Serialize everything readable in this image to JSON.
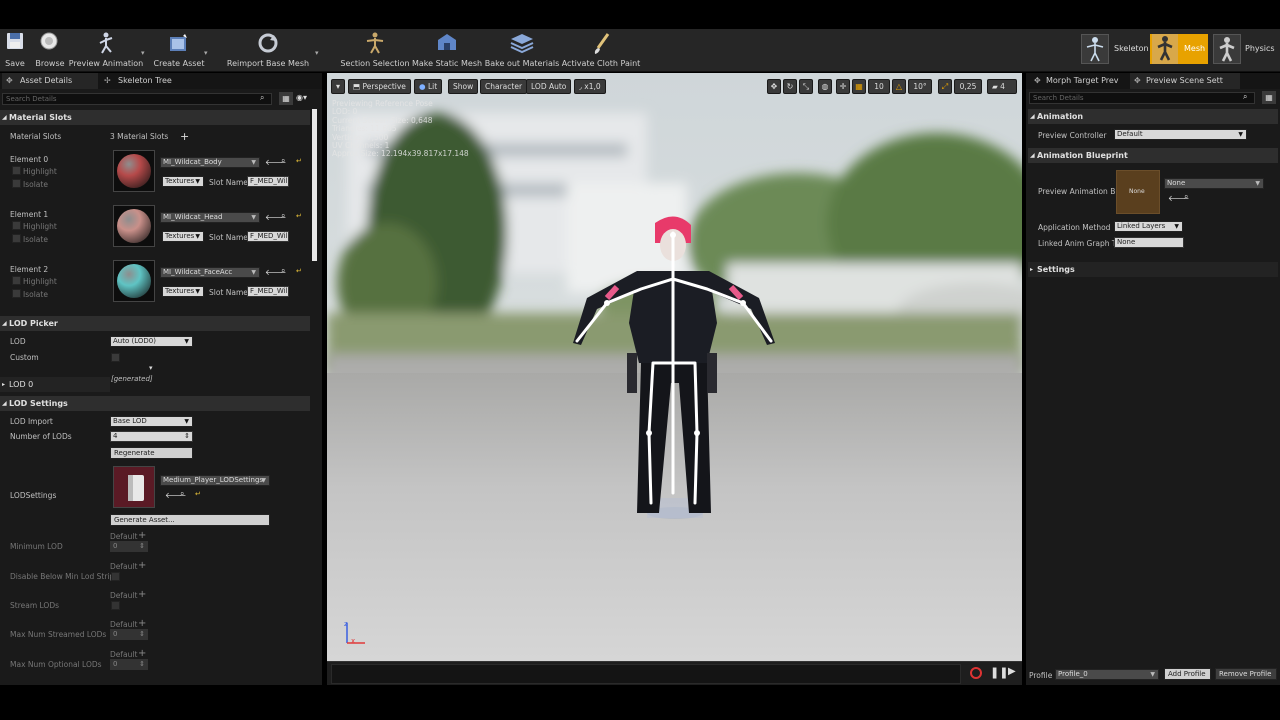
{
  "toolbar": {
    "save": "Save",
    "browse": "Browse",
    "preview_animation": "Preview Animation",
    "create_asset": "Create Asset",
    "reimport_base_mesh": "Reimport Base Mesh",
    "section_selection": "Section Selection",
    "make_static_mesh": "Make Static Mesh",
    "bake_out_materials": "Bake out Materials",
    "activate_cloth_paint": "Activate Cloth Paint",
    "modes": [
      "Skeleton",
      "Mesh",
      "Physics"
    ],
    "active_mode": "Mesh"
  },
  "left_panel": {
    "tabs": [
      "Asset Details",
      "Skeleton Tree"
    ],
    "search_placeholder": "Search Details",
    "material_slots": {
      "header": "Material Slots",
      "label": "Material Slots",
      "count": "3 Material Slots",
      "elements": [
        {
          "label": "Element 0",
          "material": "MI_Wildcat_Body",
          "slot_name": "F_MED_Wil",
          "thumb": "#b64a4a"
        },
        {
          "label": "Element 1",
          "material": "MI_Wildcat_Head",
          "slot_name": "F_MED_Wil",
          "thumb": "#c9908a"
        },
        {
          "label": "Element 2",
          "material": "MI_Wildcat_FaceAcc",
          "slot_name": "F_MED_Wil",
          "thumb": "#5fc4c4"
        }
      ],
      "highlight": "Highlight",
      "isolate": "Isolate",
      "textures": "Textures",
      "slot_name_label": "Slot Name"
    },
    "lod_picker": {
      "header": "LOD Picker",
      "lod_label": "LOD",
      "lod_value": "Auto (LOD0)",
      "custom_label": "Custom",
      "generated": "[generated]"
    },
    "lod0": {
      "header": "LOD 0"
    },
    "lod_settings": {
      "header": "LOD Settings",
      "lod_import_label": "LOD Import",
      "lod_import_value": "Base LOD",
      "number_of_lods_label": "Number of LODs",
      "number_of_lods_value": "4",
      "regenerate": "Regenerate",
      "lodsettings_label": "LODSettings",
      "lodsettings_value": "Medium_Player_LODSettings",
      "generate_asset": "Generate Asset...",
      "minimum_lod_label": "Minimum LOD",
      "disable_below_label": "Disable Below Min Lod Stripp",
      "stream_lods_label": "Stream LODs",
      "max_streamed_label": "Max Num Streamed LODs",
      "max_optional_label": "Max Num Optional LODs",
      "default": "Default",
      "zero": "0"
    }
  },
  "viewport": {
    "perspective": "Perspective",
    "lit": "Lit",
    "show": "Show",
    "character": "Character",
    "lod_auto": "LOD Auto",
    "play_rate": "x1,0",
    "grid_snap": "10",
    "angle_snap": "10°",
    "scale_snap": "0,25",
    "camera_speed": "4",
    "stats": [
      "Previewing Reference Pose",
      "LOD: 0",
      "Current Screen Size: 0,648",
      "Triangles: 11,605",
      "Vertices: 7,500",
      "UV Channels: 1",
      "Approx Size: 12.194x39.817x17.148"
    ],
    "axis_x": "x",
    "axis_z": "z"
  },
  "right_panel": {
    "tabs": [
      "Morph Target Prev",
      "Preview Scene Sett"
    ],
    "search_placeholder": "Search Details",
    "animation_header": "Animation",
    "preview_controller_label": "Preview Controller",
    "preview_controller_value": "Default",
    "anim_blueprint_header": "Animation Blueprint",
    "preview_anim_label": "Preview Animation Bl",
    "preview_anim_thumb": "None",
    "preview_anim_value": "None",
    "application_method_label": "Application Method",
    "application_method_value": "Linked Layers",
    "linked_anim_label": "Linked Anim Graph Ta",
    "linked_anim_value": "None",
    "settings_header": "Settings",
    "profile_label": "Profile",
    "profile_value": "Profile_0",
    "add_profile": "Add Profile",
    "remove_profile": "Remove Profile"
  },
  "colors": {
    "accent_orange": "#e8a200",
    "panel": "#1a1a1a",
    "section": "#2e2e2e"
  }
}
